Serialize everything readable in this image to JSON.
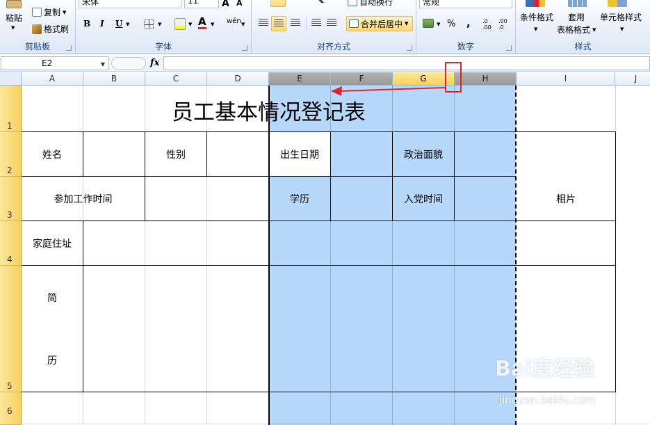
{
  "ribbon": {
    "clipboard": {
      "paste": "粘贴",
      "copy": "复制",
      "format_painter": "格式刷",
      "label": "剪贴板"
    },
    "font": {
      "font_name": "宋体",
      "font_size": "11",
      "bold": "B",
      "italic": "I",
      "underline": "U",
      "grow": "A",
      "shrink": "A",
      "wen": "wén",
      "label": "字体"
    },
    "alignment": {
      "wrap_text": "自动换行",
      "merge_center": "合并后居中",
      "label": "对齐方式"
    },
    "number": {
      "format": "常规",
      "percent": "%",
      "comma": ",",
      "inc_decimal": ".0 .00",
      "dec_decimal": ".00 .0",
      "label": "数字"
    },
    "styles": {
      "conditional": "条件格式",
      "table_format_1": "套用",
      "table_format_2": "表格格式",
      "cell_styles": "单元格样式",
      "label": "样式"
    }
  },
  "formula_bar": {
    "name_box": "E2",
    "fx": "fx",
    "content": ""
  },
  "columns": [
    "A",
    "B",
    "C",
    "D",
    "E",
    "F",
    "G",
    "H",
    "I",
    "J"
  ],
  "rows": [
    "1",
    "2",
    "3",
    "4",
    "5",
    "6"
  ],
  "sheet": {
    "title": "员工基本情况登记表",
    "name_label": "姓名",
    "gender_label": "性别",
    "birth_label": "出生日期",
    "political_label": "政治面貌",
    "work_time_label": "参加工作时间",
    "education_label": "学历",
    "party_time_label": "入党时间",
    "photo_label": "相片",
    "address_label": "家庭住址",
    "resume_1": "简",
    "resume_2": "历"
  },
  "watermark": {
    "brand": "Bai度经验",
    "url": "jingyan.baidu.com"
  },
  "colors": {
    "selection": "#b6d8fb",
    "annotation": "#e0242b",
    "ribbon_label": "#15428b"
  }
}
